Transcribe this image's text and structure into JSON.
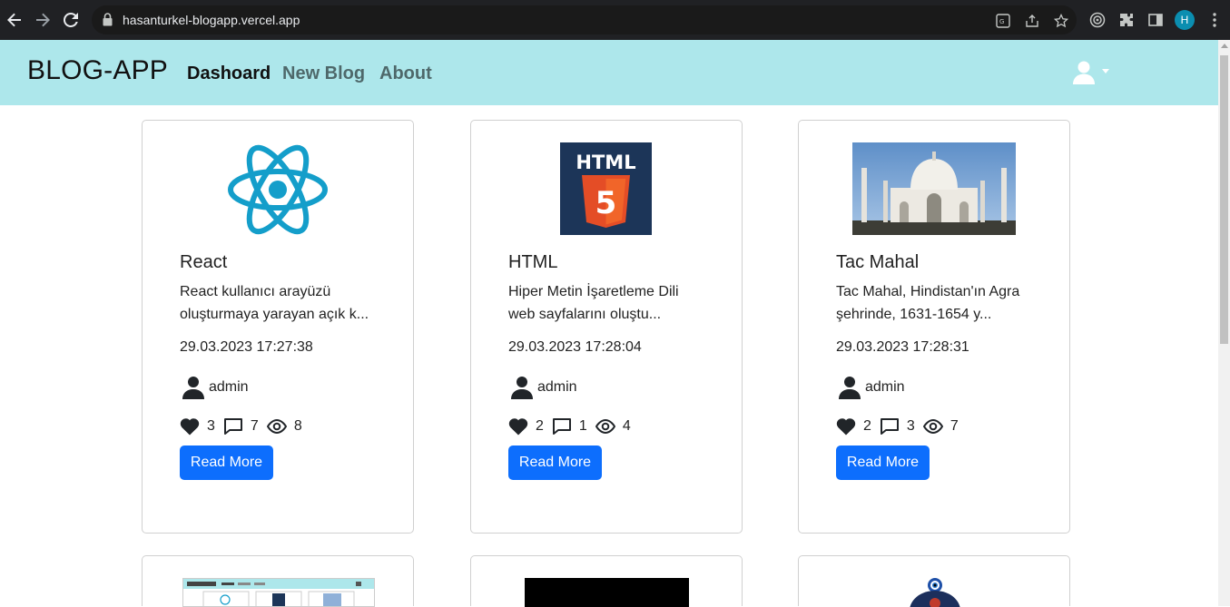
{
  "browser": {
    "url": "hasanturkel-blogapp.vercel.app",
    "profile_initial": "H"
  },
  "navbar": {
    "brand": "BLOG-APP",
    "links": [
      "Dashoard",
      "New Blog",
      "About"
    ]
  },
  "cards": [
    {
      "title": "React",
      "excerpt_line1": "React kullanıcı arayüzü",
      "excerpt_line2": "oluşturmaya yarayan açık k...",
      "date": "29.03.2023 17:27:38",
      "author": "admin",
      "likes": "3",
      "comments": "7",
      "views": "8",
      "button": "Read More"
    },
    {
      "title": "HTML",
      "excerpt_line1": "Hiper Metin İşaretleme Dili",
      "excerpt_line2": "web sayfalarını oluştu...",
      "date": "29.03.2023 17:28:04",
      "author": "admin",
      "likes": "2",
      "comments": "1",
      "views": "4",
      "button": "Read More",
      "logo_text": "HTML",
      "logo_number": "5"
    },
    {
      "title": "Tac Mahal",
      "excerpt_line1": "Tac Mahal, Hindistan'ın Agra",
      "excerpt_line2": "şehrinde, 1631-1654 y...",
      "date": "29.03.2023 17:28:31",
      "author": "admin",
      "likes": "2",
      "comments": "3",
      "views": "7",
      "button": "Read More"
    }
  ],
  "colors": {
    "navbar_bg": "#ade7eb",
    "button_bg": "#0d6efd",
    "react_blue": "#149eca",
    "html_orange": "#e44d26",
    "html_bg": "#1c3558"
  }
}
